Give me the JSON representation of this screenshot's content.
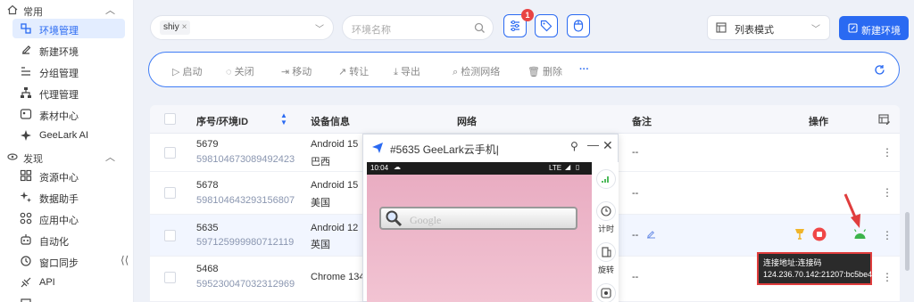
{
  "sidebar": {
    "sec_common": "常用",
    "items_common": [
      "环境管理",
      "新建环境",
      "分组管理",
      "代理管理",
      "素材中心",
      "GeeLark AI"
    ],
    "sec_discover": "发现",
    "items_discover": [
      "资源中心",
      "数据助手",
      "应用中心",
      "自动化",
      "窗口同步",
      "API"
    ],
    "collapse": "⟨⟨"
  },
  "top": {
    "tag_select": "shiy",
    "name_placeholder": "环境名称",
    "filter_badge": "1",
    "view_mode": "列表模式",
    "new_env": "新建环境"
  },
  "toolbar": {
    "start": "启动",
    "close": "关闭",
    "move": "移动",
    "transfer": "转让",
    "export": "导出",
    "check_net": "检测网络",
    "delete": "删除",
    "more": "···"
  },
  "table": {
    "headers": {
      "seq": "序号/环境ID",
      "device": "设备信息",
      "network": "网络",
      "remark": "备注",
      "action": "操作"
    },
    "rows": [
      {
        "seq": "5679",
        "id": "598104673089492423",
        "os": "Android 15",
        "region": "巴西",
        "remark": "--"
      },
      {
        "seq": "5678",
        "id": "598104643293156807",
        "os": "Android 15",
        "region": "美国",
        "remark": "--"
      },
      {
        "seq": "5635",
        "id": "597125999980712119",
        "os": "Android 12",
        "region": "英国",
        "remark": "--"
      },
      {
        "seq": "5468",
        "id": "595230047032312969",
        "os": "Chrome 134",
        "region": "",
        "remark": "--"
      }
    ]
  },
  "phone_window": {
    "title": "#5635 GeeLark云手机|",
    "time": "10:04",
    "net": "LTE",
    "search_placeholder": "Google",
    "side": [
      "计时",
      "旋转"
    ]
  },
  "tooltip": {
    "line1": "连接地址:连接码",
    "line2": "124.236.70.142:21207:bc5be4"
  },
  "colors": {
    "accent": "#2a6af2",
    "badge": "#e84343",
    "highlight": "#e03d3d",
    "android": "#3cb34a"
  }
}
